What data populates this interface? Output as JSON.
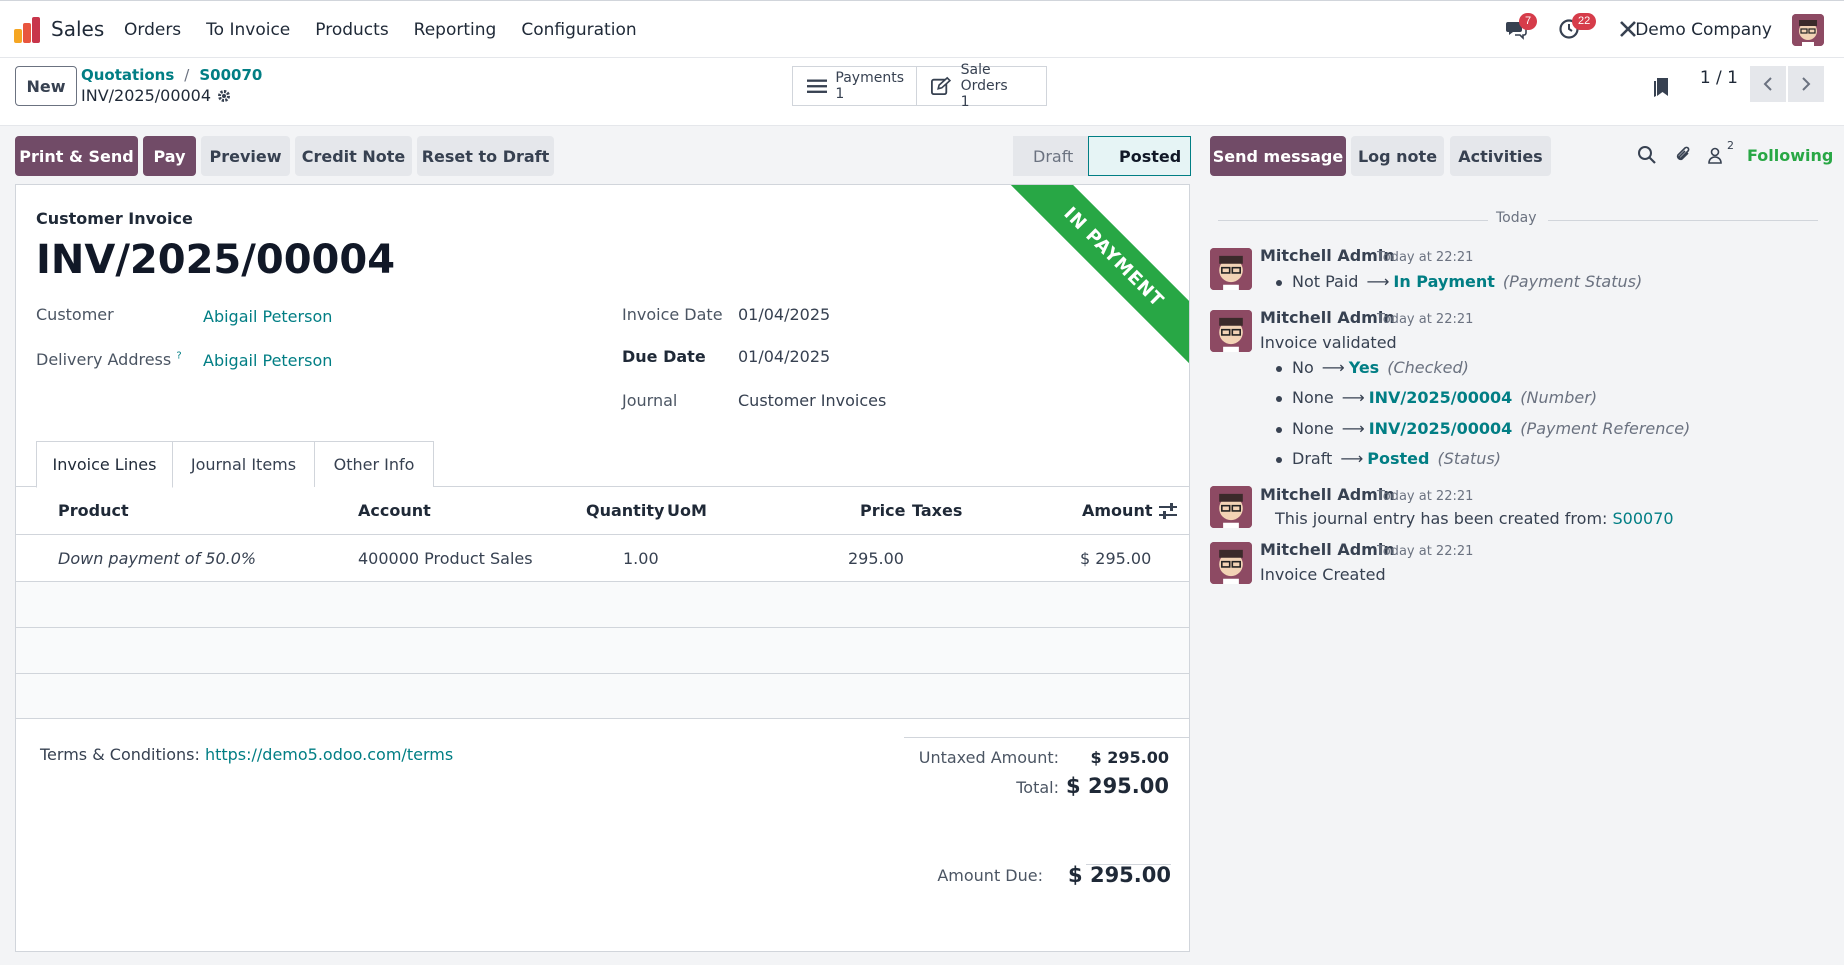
{
  "navbar": {
    "app_name": "Sales",
    "menu": [
      "Orders",
      "To Invoice",
      "Products",
      "Reporting",
      "Configuration"
    ],
    "messages_count": "7",
    "activities_count": "22",
    "company": "Demo Company"
  },
  "control": {
    "new_label": "New",
    "breadcrumb": [
      "Quotations",
      "S00070"
    ],
    "record_name": "INV/2025/00004",
    "smart_buttons": [
      {
        "label": "Payments",
        "count": "1"
      },
      {
        "label": "Sale Orders",
        "count": "1"
      }
    ],
    "pager": "1 / 1"
  },
  "actions": {
    "print_send": "Print & Send",
    "pay": "Pay",
    "preview": "Preview",
    "credit_note": "Credit Note",
    "reset_draft": "Reset to Draft"
  },
  "status": {
    "draft": "Draft",
    "posted": "Posted"
  },
  "invoice": {
    "ribbon": "IN PAYMENT",
    "type": "Customer Invoice",
    "number": "INV/2025/00004",
    "customer_label": "Customer",
    "customer": "Abigail Peterson",
    "delivery_label": "Delivery Address",
    "delivery_help": "?",
    "delivery": "Abigail Peterson",
    "invoice_date_label": "Invoice Date",
    "invoice_date": "01/04/2025",
    "due_date_label": "Due Date",
    "due_date": "01/04/2025",
    "journal_label": "Journal",
    "journal": "Customer Invoices"
  },
  "tabs": [
    "Invoice Lines",
    "Journal Items",
    "Other Info"
  ],
  "lines": {
    "headers": [
      "Product",
      "Account",
      "Quantity",
      "UoM",
      "Price",
      "Taxes",
      "Amount"
    ],
    "rows": [
      {
        "product": "Down payment of 50.0%",
        "account": "400000 Product Sales",
        "quantity": "1.00",
        "uom": "",
        "price": "295.00",
        "taxes": "",
        "amount": "$ 295.00"
      }
    ]
  },
  "footer": {
    "terms_label": "Terms & Conditions:",
    "terms_link": "https://demo5.odoo.com/terms",
    "untaxed_label": "Untaxed Amount:",
    "untaxed": "$ 295.00",
    "total_label": "Total:",
    "total": "$ 295.00",
    "due_label": "Amount Due:",
    "due": "$ 295.00"
  },
  "chatter": {
    "send_message": "Send message",
    "log_note": "Log note",
    "activities": "Activities",
    "followers_count": "2",
    "following": "Following",
    "today": "Today",
    "messages": [
      {
        "author": "Mitchell Admin",
        "time": "Today at 22:21",
        "changes": [
          {
            "old": "Not Paid",
            "new": "In Payment",
            "field": "(Payment Status)"
          }
        ]
      },
      {
        "author": "Mitchell Admin",
        "time": "Today at 22:21",
        "body": "Invoice validated",
        "changes": [
          {
            "old": "No",
            "new": "Yes",
            "field": "(Checked)"
          },
          {
            "old": "None",
            "new": "INV/2025/00004",
            "field": "(Number)"
          },
          {
            "old": "None",
            "new": "INV/2025/00004",
            "field": "(Payment Reference)"
          },
          {
            "old": "Draft",
            "new": "Posted",
            "field": "(Status)"
          }
        ]
      },
      {
        "author": "Mitchell Admin",
        "time": "Today at 22:21",
        "body": "This journal entry has been created from:",
        "link": "S00070"
      },
      {
        "author": "Mitchell Admin",
        "time": "Today at 22:21",
        "body": "Invoice Created"
      }
    ]
  }
}
